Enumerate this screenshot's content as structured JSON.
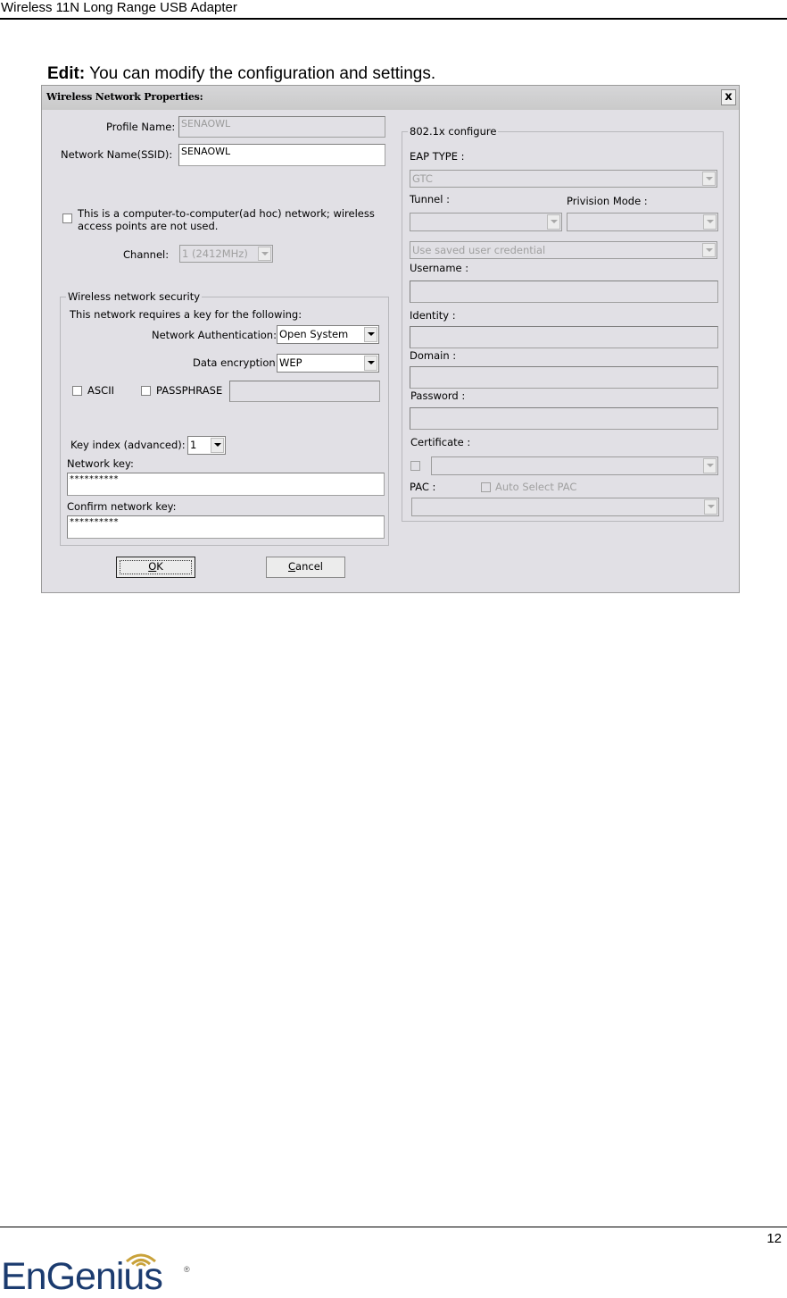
{
  "document": {
    "header_title": "Wireless 11N Long Range USB Adapter",
    "intro_bold": "Edit:",
    "intro_text": " You can modify the configuration and settings.",
    "page_number": "12",
    "brand": "EnGenius",
    "brand_mark": "®"
  },
  "dialog": {
    "title": "Wireless Network Properties:",
    "close_label": "x",
    "profile_name_label": "Profile Name:",
    "profile_name_value": "SENAOWL",
    "ssid_label": "Network Name(SSID):",
    "ssid_value": "SENAOWL",
    "adhoc_label_line1": "This is a computer-to-computer(ad hoc) network; wireless",
    "adhoc_label_line2": "access points are not used.",
    "adhoc_checked": false,
    "channel_label": "Channel:",
    "channel_value": "1  (2412MHz)",
    "security": {
      "group_title": "Wireless network security",
      "requires_text": "This network requires a key for the following:",
      "auth_label": "Network Authentication:",
      "auth_value": "Open System",
      "encryption_label": "Data encryption:",
      "encryption_value": "WEP",
      "ascii_label": "ASCII",
      "ascii_checked": false,
      "passphrase_label": "PASSPHRASE",
      "passphrase_checked": false,
      "passphrase_value": "",
      "key_index_label": "Key index (advanced):",
      "key_index_value": "1",
      "network_key_label": "Network key:",
      "network_key_value": "**********",
      "confirm_key_label": "Confirm network key:",
      "confirm_key_value": "**********"
    },
    "dot1x": {
      "group_title": "802.1x configure",
      "eap_type_label": "EAP TYPE :",
      "eap_type_value": "GTC",
      "tunnel_label": "Tunnel :",
      "tunnel_value": "",
      "provision_mode_label": "Privision Mode :",
      "provision_mode_value": "",
      "credential_value": "Use saved user credential",
      "username_label": "Username :",
      "username_value": "",
      "identity_label": "Identity :",
      "identity_value": "",
      "domain_label": "Domain :",
      "domain_value": "",
      "password_label": "Password :",
      "password_value": "",
      "certificate_label": "Certificate :",
      "certificate_checked": false,
      "certificate_value": "",
      "pac_label": "PAC :",
      "auto_select_pac_label": "Auto Select PAC",
      "auto_select_pac_checked": false,
      "pac_value": ""
    },
    "ok_label": "OK",
    "ok_mnemonic": "O",
    "ok_rest": "K",
    "cancel_label": "Cancel",
    "cancel_mnemonic": "C",
    "cancel_rest": "ancel"
  }
}
